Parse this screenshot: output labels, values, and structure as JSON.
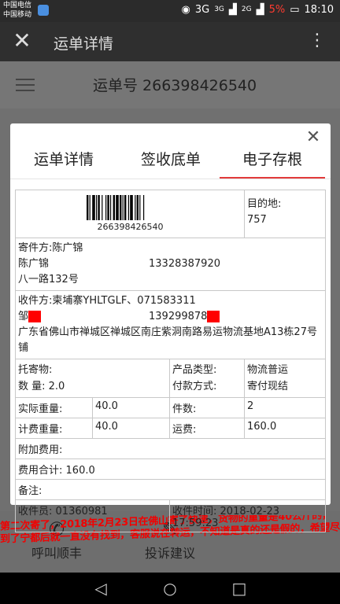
{
  "status_bar": {
    "carrier_1": "中国电信",
    "carrier_2": "中国移动",
    "net_1": "3G",
    "net_2": "3G",
    "net_3": "2G",
    "battery": "5%",
    "time": "18:10"
  },
  "app_bar": {
    "title": "运单详情"
  },
  "background": {
    "order_label": "运单号 266398426540"
  },
  "bottom_bar": {
    "item_1": "呼叫顺丰",
    "item_2": "投诉建议",
    "item_3": ""
  },
  "modal": {
    "tabs": [
      "运单详情",
      "签收底单",
      "电子存根"
    ],
    "active_tab": 2
  },
  "waybill": {
    "barcode_number": "266398426540",
    "destination_label": "目的地:",
    "destination_code": "757",
    "sender_label": "寄件方:",
    "sender_company": "陈广锦",
    "sender_name": "陈广锦",
    "sender_phone": "13328387920",
    "sender_address": "八一路132号",
    "receiver_label": "收件方:",
    "receiver_company": "柬埔寨YHLTGLF、071583311",
    "receiver_name": "邹",
    "receiver_phone": "139299878",
    "receiver_address": "广东省佛山市禅城区禅城区南庄紫洞南路易运物流基地A13栋27号铺",
    "consign_label": "托寄物:",
    "quantity_label": "数  量:",
    "quantity_value": "2.0",
    "product_type_label": "产品类型:",
    "product_type_value": "物流普运",
    "payment_label": "付款方式:",
    "payment_value": "寄付现结",
    "actual_weight_label": "实际重量:",
    "actual_weight_value": "40.0",
    "pieces_label": "件数:",
    "pieces_value": "2",
    "billed_weight_label": "计费重量:",
    "billed_weight_value": "40.0",
    "freight_label": "运费:",
    "freight_value": "160.0",
    "extra_fee_label": "附加费用:",
    "total_fee_label": "费用合计:",
    "total_fee_value": "160.0",
    "remark_label": "备注:",
    "collector_label": "收件员:",
    "collector_value": "01360981",
    "collect_time_label": "收件时间:",
    "collect_time_value": "2018-02-23 17:59:23"
  },
  "watermark": {
    "line_1": "第二次寄了，2018年2月23日在佛山寄了快递，货物的重量是40公斤的，",
    "line_2": "到了宁都后就一直没有找到，客服说在转运，不知道是真的还是假的，希望尽快处理"
  },
  "colors": {
    "accent": "#e23a3a",
    "redaction": "#ff0000",
    "battery_low": "#ff3b30"
  },
  "icons": [
    "close-icon",
    "more-icon",
    "menu-icon",
    "phone-icon",
    "complaint-icon",
    "back-icon",
    "home-icon",
    "recents-icon"
  ]
}
